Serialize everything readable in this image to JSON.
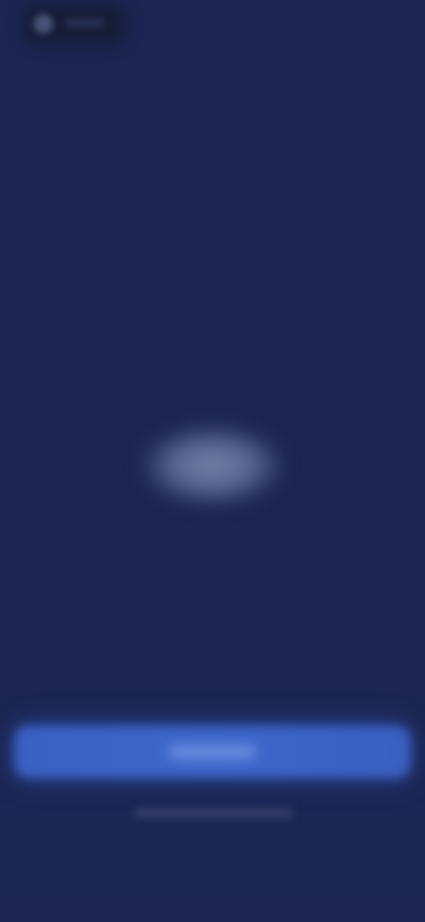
{
  "colors": {
    "background": "#1b2550",
    "primary_button": "#3d66c9",
    "logo_glow": "#7380a8",
    "top_control": "#171d37"
  },
  "icons": {
    "top_left": "brand-icon",
    "center": "logo-icon"
  },
  "primary_button": {
    "label": ""
  },
  "secondary_link": {
    "label": ""
  }
}
